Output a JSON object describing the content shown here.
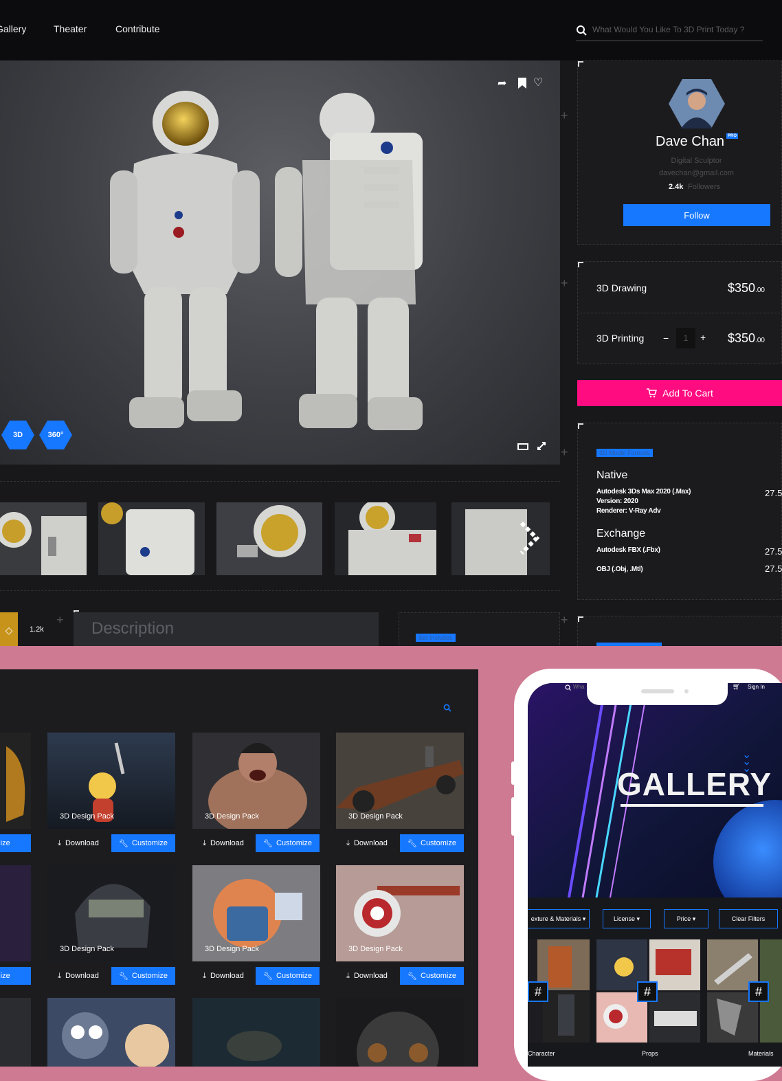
{
  "nav": {
    "gallery": "Gallery",
    "theater": "Theater",
    "contribute": "Contribute",
    "search_placeholder": "What Would You Like To 3D Print Today ?"
  },
  "viewer": {
    "badge_3d": "3D",
    "badge_360": "360°",
    "views_count": "1.2k",
    "description_placeholder": "Description",
    "set_includes": "Set Includes"
  },
  "profile": {
    "name": "Dave Chan",
    "pro": "PRO",
    "title": "Digital Sculptor",
    "email": "davechan@gmail.com",
    "followers_count": "2.4k",
    "followers_label": "Followers",
    "follow": "Follow"
  },
  "pricing": {
    "drawing_label": "3D Drawing",
    "drawing_price": "$350",
    "drawing_cents": ".00",
    "printing_label": "3D Printing",
    "printing_price": "$350",
    "printing_cents": ".00",
    "qty": "1",
    "minus": "−",
    "plus": "+",
    "add_to_cart": "Add To Cart"
  },
  "formats": {
    "badge": "3D Model Formats",
    "native_title": "Native",
    "native_lines": [
      "Autodesk 3Ds Max 2020 (.Max)",
      "Version: 2020",
      "Renderer: V-Ray Adv"
    ],
    "native_size": "27.5",
    "exchange_title": "Exchange",
    "exchange_fbx": "Autodesk FBX (.Fbx)",
    "exchange_obj": "OBJ (.Obj, .Mtl)",
    "exchange_fbx_size": "27.5",
    "exchange_obj_size": "27.5"
  },
  "gallery": {
    "caption": "3D Design Pack",
    "download": "Download",
    "customize": "Customize",
    "customize_partial": "tomize"
  },
  "mobile": {
    "hero": "GALLERY",
    "search_partial": "Wha",
    "sign_in": "Sign In",
    "filters": [
      "exture & Materials ▾",
      "License ▾",
      "Price ▾",
      "Clear Filters"
    ],
    "categories": [
      "Character",
      "Props",
      "Materials"
    ],
    "hash": "#"
  },
  "colors": {
    "accent_blue": "#1677ff",
    "cart_pink": "#ff0c80",
    "backdrop": "#cf7a93"
  }
}
